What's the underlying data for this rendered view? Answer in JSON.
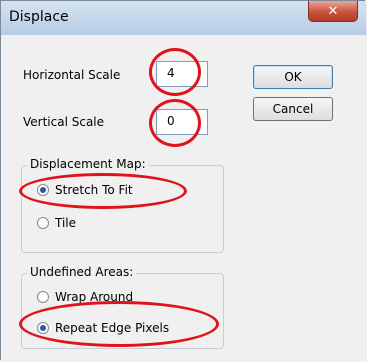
{
  "window": {
    "title": "Displace",
    "close_glyph": "✕"
  },
  "fields": {
    "horizontal_scale": {
      "label": "Horizontal Scale",
      "value": "4"
    },
    "vertical_scale": {
      "label": "Vertical Scale",
      "value": "0"
    }
  },
  "buttons": {
    "ok": "OK",
    "cancel": "Cancel"
  },
  "displacement_map": {
    "legend": "Displacement Map:",
    "options": [
      {
        "label": "Stretch To Fit",
        "checked": true
      },
      {
        "label": "Tile",
        "checked": false
      }
    ]
  },
  "undefined_areas": {
    "legend": "Undefined Areas:",
    "options": [
      {
        "label": "Wrap Around",
        "checked": false
      },
      {
        "label": "Repeat Edge Pixels",
        "checked": true
      }
    ]
  },
  "highlight_color": "#e0131b"
}
